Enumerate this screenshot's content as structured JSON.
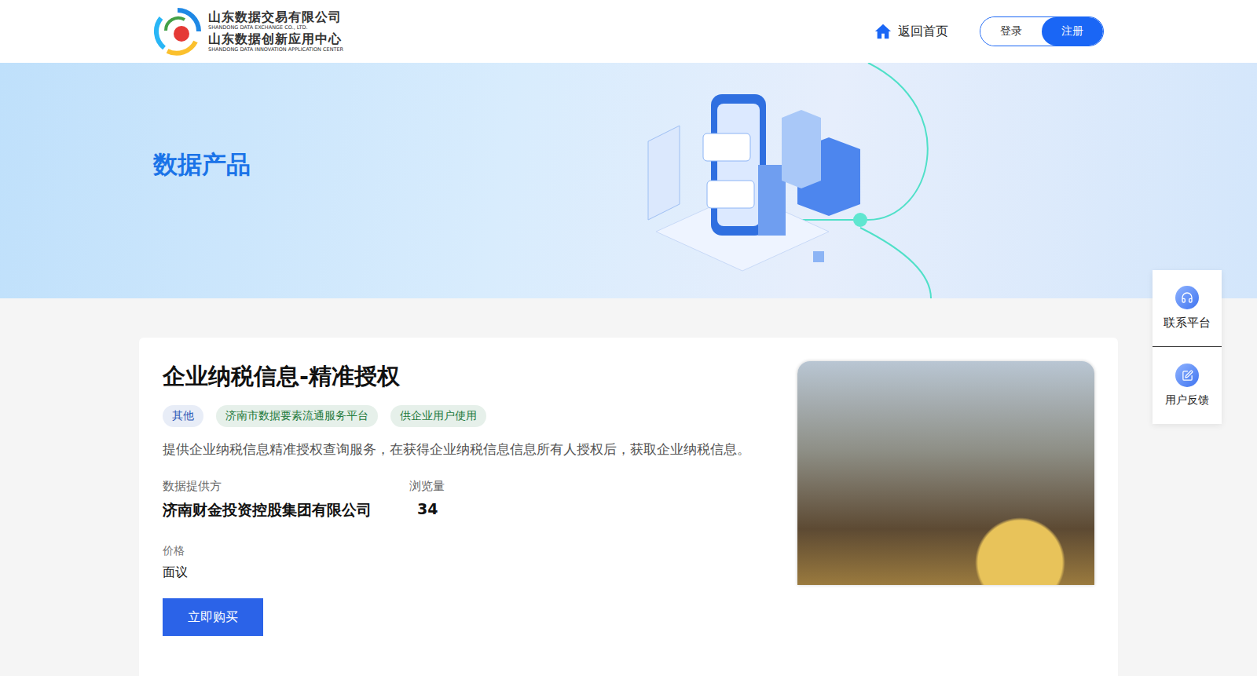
{
  "header": {
    "logo": {
      "lines": [
        {
          "text": "山东数据交易有限公司",
          "kind": "cn"
        },
        {
          "text": "SHANDONG DATA EXCHANGE CO., LTD.",
          "kind": "en"
        },
        {
          "text": "山东数据创新应用中心",
          "kind": "cn"
        },
        {
          "text": "SHANDONG DATA INNOVATION APPLICATION CENTER",
          "kind": "en"
        }
      ]
    },
    "home": "返回首页",
    "auth": [
      {
        "label": "登录",
        "selected": false
      },
      {
        "label": "注册",
        "selected": true
      }
    ]
  },
  "banner": {
    "title": "数据产品"
  },
  "product": {
    "title": "企业纳税信息-精准授权",
    "tags": [
      {
        "label": "其他",
        "color": "#2c57b5"
      },
      {
        "label": "济南市数据要素流通服务平台",
        "color": "#1f7a3c"
      },
      {
        "label": "供企业用户使用",
        "color": "#1f7a3c"
      }
    ],
    "description": "提供企业纳税信息精准授权查询服务，在获得企业纳税信息信息所有人授权后，获取企业纳税信息。",
    "provider": {
      "label": "数据提供方",
      "value": "济南财金投资控股集团有限公司"
    },
    "views": {
      "label": "浏览量",
      "value": "34"
    },
    "price": {
      "label": "价格",
      "value": "面议"
    },
    "buy_button": "立即购买"
  },
  "float_menu": [
    {
      "label": "联系平台",
      "kind": "contact"
    },
    {
      "label": "用户反馈",
      "kind": "feedback"
    }
  ]
}
